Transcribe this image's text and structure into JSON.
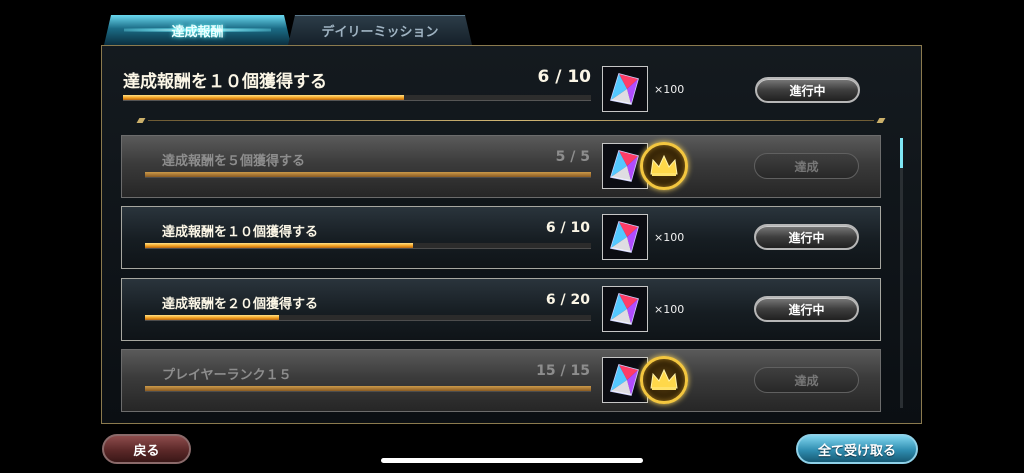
{
  "tabs": [
    {
      "label": "達成報酬",
      "active": true
    },
    {
      "label": "デイリーミッション",
      "active": false
    }
  ],
  "featured": {
    "title": "達成報酬を１０個獲得する",
    "progress": "6 / 10",
    "progress_fraction": 0.6,
    "reward_qty": "×100",
    "status": "進行中"
  },
  "missions": [
    {
      "title": "達成報酬を５個獲得する",
      "progress": "5 / 5",
      "progress_fraction": 1.0,
      "reward_qty": "",
      "status": "達成",
      "completed": true
    },
    {
      "title": "達成報酬を１０個獲得する",
      "progress": "6 / 10",
      "progress_fraction": 0.6,
      "reward_qty": "×100",
      "status": "進行中",
      "completed": false
    },
    {
      "title": "達成報酬を２０個獲得する",
      "progress": "6 / 20",
      "progress_fraction": 0.3,
      "reward_qty": "×100",
      "status": "進行中",
      "completed": false
    },
    {
      "title": "プレイヤーランク１５",
      "progress": "15 / 15",
      "progress_fraction": 1.0,
      "reward_qty": "",
      "status": "達成",
      "completed": true
    }
  ],
  "footer": {
    "back_label": "戻る",
    "claim_all_label": "全て受け取る"
  },
  "colors": {
    "accent_cyan": "#6ad8ef",
    "progress_orange": "#f4a221",
    "panel_border_gold": "#8b7a4e"
  },
  "icons": {
    "reward": "gem-crystal-icon",
    "completed": "crown-icon"
  }
}
